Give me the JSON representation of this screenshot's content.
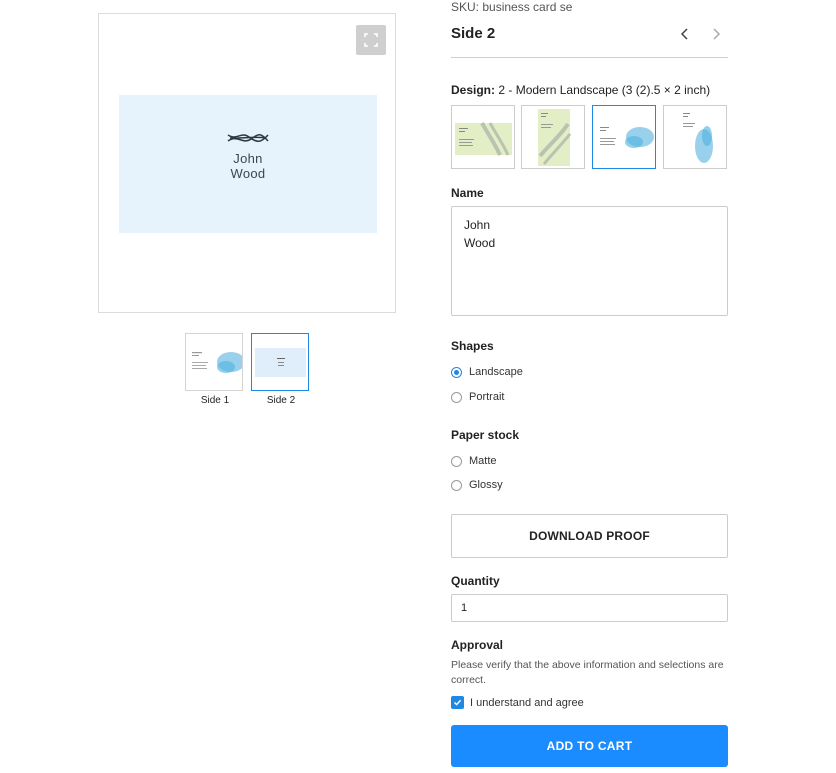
{
  "sku": "SKU: business card se",
  "side_title": "Side 2",
  "nav": {
    "prev_icon": "chevron-left-icon",
    "next_icon": "chevron-right-icon"
  },
  "design": {
    "label_prefix": "Design:",
    "label_value": "2 - Modern Landscape (3 (2).5 × 2 inch)",
    "options": [
      {
        "name": "green-landscape",
        "selected": false
      },
      {
        "name": "green-portrait",
        "selected": false
      },
      {
        "name": "blue-landscape",
        "selected": true
      },
      {
        "name": "blue-portrait",
        "selected": false
      }
    ]
  },
  "preview": {
    "card_name_line1": "John",
    "card_name_line2": "Wood",
    "fullscreen_icon": "expand-icon",
    "thumbnails": [
      {
        "label": "Side 1",
        "active": false
      },
      {
        "label": "Side 2",
        "active": true
      }
    ]
  },
  "name_section": {
    "label": "Name",
    "value": "John\nWood"
  },
  "shapes": {
    "label": "Shapes",
    "options": [
      {
        "label": "Landscape",
        "checked": true
      },
      {
        "label": "Portrait",
        "checked": false
      }
    ]
  },
  "paper_stock": {
    "label": "Paper stock",
    "options": [
      {
        "label": "Matte",
        "checked": false
      },
      {
        "label": "Glossy",
        "checked": false
      }
    ]
  },
  "download_proof_label": "DOWNLOAD PROOF",
  "quantity": {
    "label": "Quantity",
    "value": "1"
  },
  "approval": {
    "label": "Approval",
    "text": "Please verify that the above information and selections are correct.",
    "checkbox_label": "I understand and agree",
    "checked": true
  },
  "add_to_cart_label": "ADD TO CART",
  "colors": {
    "accent": "#1a8cff",
    "selected_border": "#1e88e5",
    "card_bg": "#e6f2fc"
  }
}
